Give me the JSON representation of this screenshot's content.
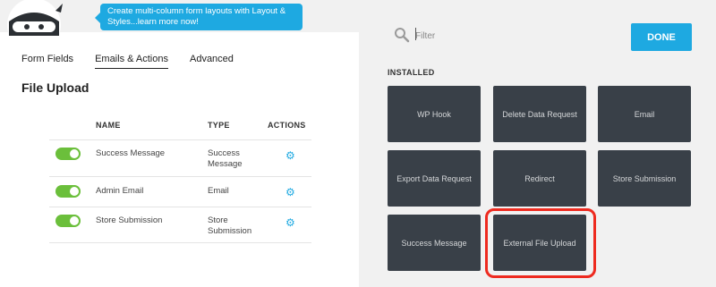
{
  "callout": {
    "text": "Create multi-column form layouts with Layout & Styles...learn more now!"
  },
  "tabs": [
    {
      "label": "Form Fields",
      "active": false
    },
    {
      "label": "Emails & Actions",
      "active": true
    },
    {
      "label": "Advanced",
      "active": false
    }
  ],
  "section_title": "File Upload",
  "table": {
    "columns": [
      "NAME",
      "TYPE",
      "ACTIONS"
    ],
    "rows": [
      {
        "enabled": true,
        "name": "Success Message",
        "type": "Success Message"
      },
      {
        "enabled": true,
        "name": "Admin Email",
        "type": "Email"
      },
      {
        "enabled": true,
        "name": "Store Submission",
        "type": "Store Submission"
      }
    ]
  },
  "filter": {
    "placeholder": "Filter",
    "value": ""
  },
  "done_label": "DONE",
  "installed_label": "INSTALLED",
  "actions": [
    {
      "label": "WP Hook"
    },
    {
      "label": "Delete Data Request"
    },
    {
      "label": "Email"
    },
    {
      "label": "Export Data Request"
    },
    {
      "label": "Redirect"
    },
    {
      "label": "Store Submission"
    },
    {
      "label": "Success Message"
    },
    {
      "label": "External File Upload",
      "highlighted": true
    }
  ],
  "colors": {
    "accent": "#1ea9e1",
    "tile": "#394048",
    "toggle_on": "#6bbf3b",
    "highlight": "#ee2a1f"
  },
  "icons": [
    "ninja-logo-icon",
    "search-icon",
    "gear-icon"
  ]
}
